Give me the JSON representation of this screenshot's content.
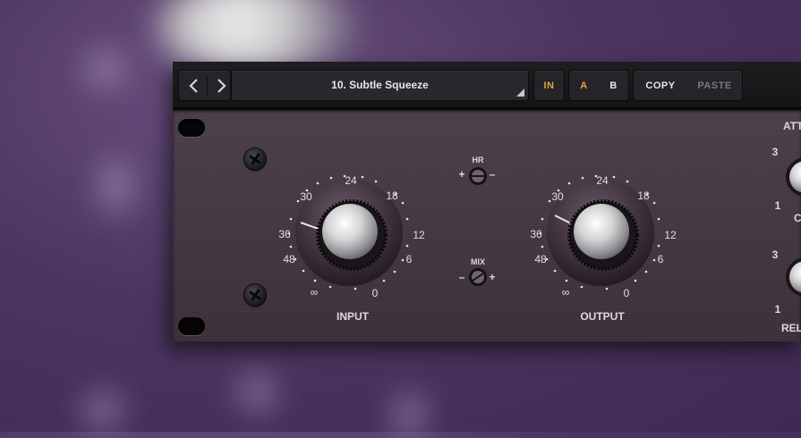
{
  "toolbar": {
    "prev_icon": "chevron-left-icon",
    "next_icon": "chevron-right-icon",
    "preset_name": "10. Subtle Squeeze",
    "in_label": "IN",
    "a_label": "A",
    "b_label": "B",
    "copy_label": "COPY",
    "paste_label": "PASTE"
  },
  "controls": {
    "input": {
      "label": "INPUT",
      "scale": [
        "∞",
        "48",
        "36",
        "30",
        "24",
        "18",
        "12",
        "6",
        "0"
      ]
    },
    "output": {
      "label": "OUTPUT",
      "scale": [
        "∞",
        "48",
        "36",
        "30",
        "24",
        "18",
        "12",
        "6",
        "0"
      ]
    },
    "hr": {
      "label": "HR",
      "plus": "+",
      "minus": "–"
    },
    "mix": {
      "label": "MIX",
      "minus": "–",
      "plus": "+"
    },
    "attack": {
      "label": "ATT",
      "scale_top": "3",
      "scale_bottom": "1",
      "label_fragment": "C"
    },
    "release": {
      "label": "REL",
      "scale_top": "3",
      "scale_bottom": "1"
    }
  },
  "colors": {
    "accent_orange": "#e0a43c",
    "faceplate": "#463a45",
    "background_purple": "#4c3560"
  }
}
